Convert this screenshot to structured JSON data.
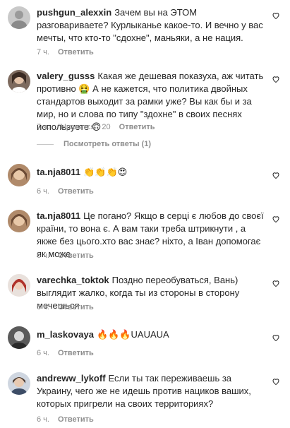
{
  "comments": [
    {
      "user": "pushgun_alexxin",
      "text": "Зачем вы на ЭТОМ разговариваете? Курлыканье какое-то. И вечно у вас мечты, что кто-то \"сдохне\", маньяки, а не нация.",
      "time": "7 ч.",
      "reply": "Ответить"
    },
    {
      "user": "valery_gusss",
      "text": "Какая же дешевая показуха, аж читать противно 🤮 А не кажется, что политика двойных стандартов выходит за рамки уже? Вы как бы и за мир, но и слова по типу \"здохне\" в своих песнях используете 🙃",
      "time": "7 ч.",
      "likes": "\"Нравится\": 20",
      "reply": "Ответить",
      "view_replies": "Посмотреть ответы (1)"
    },
    {
      "user": "ta.nja8011",
      "text": "👏👏👏😍",
      "time": "6 ч.",
      "reply": "Ответить"
    },
    {
      "user": "ta.nja8011",
      "text": "Це погано? Якщо в серці є любов до своєї країни, то вона є. А вам таки треба штрикнути , а якже без цього.хто вас знає? ніхто, а Іван допомогає як може",
      "time": "6 ч.",
      "reply": "Ответить"
    },
    {
      "user": "varechka_toktok",
      "text": "Поздно переобуваться, Вань) выглядит жалко, когда ты из стороны в сторону мечешься",
      "time": "6 ч.",
      "reply": "Ответить"
    },
    {
      "user": "m_laskovaya",
      "text": "🔥🔥🔥UAUAUA",
      "time": "6 ч.",
      "reply": "Ответить"
    },
    {
      "user": "andreww_lykoff",
      "text": "Если ты так переживаешь за Украину, чего же не идешь против нациков ваших, которых пригрели на своих территориях?",
      "time": "6 ч.",
      "reply": "Ответить"
    }
  ],
  "colors": {
    "text": "#262626",
    "muted": "#8e8e8e"
  },
  "icons": {
    "like": "heart-icon"
  }
}
